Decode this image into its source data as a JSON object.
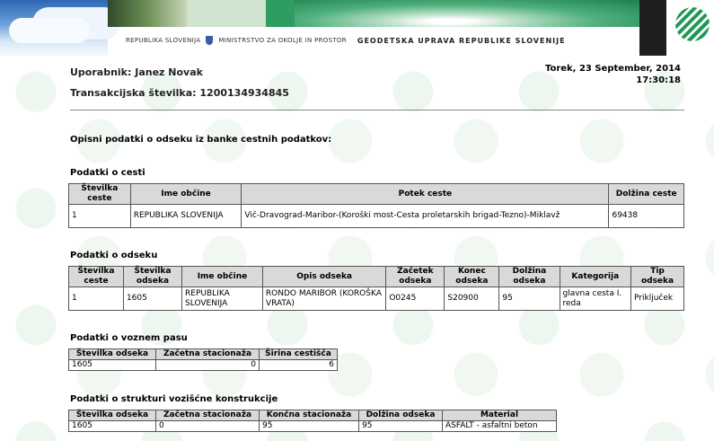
{
  "header": {
    "text_republika": "REPUBLIKA SLOVENIJA",
    "text_ministrstvo": "MINISTRSTVO ZA OKOLJE IN PROSTOR",
    "text_gu": "GEODETSKA UPRAVA REPUBLIKE SLOVENIJE"
  },
  "user": {
    "label": "Uporabnik:",
    "name": "Janez Novak",
    "transaction_label": "Transakcijska številka:",
    "transaction_number": "1200134934845"
  },
  "datetime": {
    "date": "Torek, 23 September, 2014",
    "time": "17:30:18"
  },
  "intro": "Opisni podatki o odseku iz banke cestnih podatkov:",
  "cesta": {
    "title": "Podatki o cesti",
    "headers": [
      "Številka ceste",
      "Ime občine",
      "Potek ceste",
      "Dolžina ceste"
    ],
    "row": [
      "1",
      "REPUBLIKA SLOVENIJA",
      "Vič-Dravograd-Maribor-(Koroški most-Cesta proletarskih brigad-Tezno)-Miklavž",
      "69438"
    ]
  },
  "odsek": {
    "title": "Podatki o odseku",
    "headers": [
      "Številka ceste",
      "Številka odseka",
      "Ime občine",
      "Opis odseka",
      "Začetek odseka",
      "Konec odseka",
      "Dolžina odseka",
      "Kategorija",
      "Tip odseka"
    ],
    "row": [
      "1",
      "1605",
      "REPUBLIKA SLOVENIJA",
      "RONDO MARIBOR (KOROŠKA VRATA)",
      "O0245",
      "S20900",
      "95",
      "glavna cesta I. reda",
      "Priključek"
    ]
  },
  "pas": {
    "title": "Podatki o voznem pasu",
    "headers": [
      "Številka odseka",
      "Začetna stacionaža",
      "Širina cestišča"
    ],
    "row": [
      "1605",
      "0",
      "6"
    ]
  },
  "struktura": {
    "title": "Podatki o strukturi vozišćne konstrukcije",
    "headers": [
      "Številka odseka",
      "Začetna stacionaža",
      "Končna stacionaža",
      "Dolžina odseka",
      "Material"
    ],
    "row": [
      "1605",
      "0",
      "95",
      "95",
      "ASFALT - asfaltni beton"
    ]
  }
}
